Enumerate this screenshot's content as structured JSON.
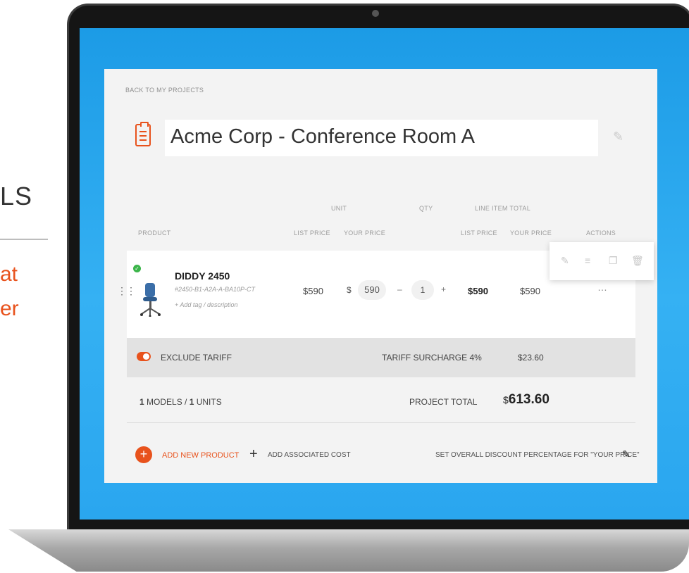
{
  "slide": {
    "heading": "LS",
    "line1": "at",
    "line2": "er"
  },
  "app": {
    "back_link": "BACK TO MY PROJECTS",
    "project_title": "Acme Corp - Conference Room A",
    "columns": {
      "unit": "UNIT",
      "qty": "QTY",
      "line_item_total": "LINE ITEM TOTAL",
      "product": "PRODUCT",
      "list_price": "LIST PRICE",
      "your_price": "YOUR PRICE",
      "total_list_price": "LIST PRICE",
      "total_your_price": "YOUR PRICE",
      "actions": "ACTIONS"
    },
    "line_item": {
      "name": "DIDDY 2450",
      "sku": "#2450-B1-A2A-A-BA10P-CT",
      "add_tag": "+ Add tag / description",
      "unit_list_price": "$590",
      "currency": "$",
      "your_price_value": "590",
      "qty_minus": "–",
      "qty_value": "1",
      "qty_plus": "+",
      "total_list_price": "$590",
      "total_your_price": "$590",
      "actions_more": "…"
    },
    "tariff": {
      "toggle_label": "EXCLUDE TARIFF",
      "surcharge_label": "TARIFF SURCHARGE 4%",
      "surcharge_value": "$23.60"
    },
    "summary": {
      "models_count": "1",
      "models_label": " MODELS / ",
      "units_count": "1",
      "units_label": " UNITS",
      "project_total_label": "PROJECT TOTAL",
      "project_total_currency": "$",
      "project_total_value": "613.60"
    },
    "footer": {
      "add_product": "ADD NEW PRODUCT",
      "add_cost": "ADD ASSOCIATED COST",
      "discount": "SET OVERALL DISCOUNT PERCENTAGE FOR \"YOUR PRICE\""
    },
    "icons": {
      "project": "clipboard-icon",
      "edit": "pencil-icon",
      "status": "check-circle-icon",
      "drag": "drag-handle-icon",
      "product_image": "office-chair-icon",
      "actions": [
        "pencil-icon",
        "list-icon",
        "copy-icon",
        "trash-icon"
      ]
    },
    "colors": {
      "accent": "#e8521c",
      "success": "#3bb54a",
      "screen_blue": "#2aa6ef"
    }
  }
}
